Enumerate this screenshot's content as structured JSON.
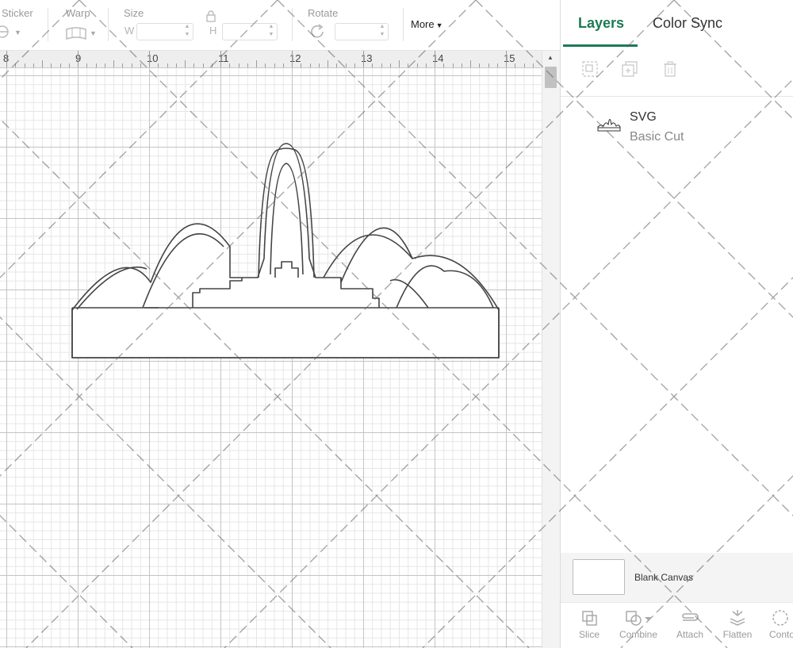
{
  "toolbar": {
    "sticker_label": "Sticker",
    "warp_label": "Warp",
    "size_label": "Size",
    "size_w_letter": "W",
    "size_h_letter": "H",
    "rotate_label": "Rotate",
    "more_label": "More"
  },
  "ruler": {
    "numbers": [
      "8",
      "9",
      "10",
      "11",
      "12",
      "13",
      "14",
      "15"
    ]
  },
  "panel": {
    "tabs": [
      {
        "label": "Layers",
        "active": true
      },
      {
        "label": "Color Sync",
        "active": false
      }
    ],
    "layers": [
      {
        "name": "SVG",
        "operation": "Basic Cut"
      }
    ],
    "canvas_label": "Blank Canvas",
    "bottom_actions": [
      {
        "label": "Slice",
        "icon": "slice-icon"
      },
      {
        "label": "Combine",
        "icon": "combine-icon"
      },
      {
        "label": "Attach",
        "icon": "attach-icon"
      },
      {
        "label": "Flatten",
        "icon": "flatten-icon"
      },
      {
        "label": "Contour",
        "icon": "contour-icon"
      }
    ]
  },
  "colors": {
    "accent": "#1c7a56",
    "grid_major": "#c4c4c4",
    "grid_minor": "#e6e6e6"
  }
}
